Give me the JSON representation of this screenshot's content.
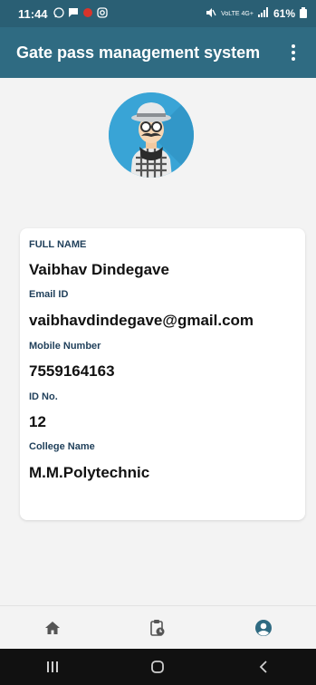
{
  "status_bar": {
    "time": "11:44",
    "signal_text": "VoLTE 4G+",
    "battery": "61%"
  },
  "app_bar": {
    "title": "Gate pass management system"
  },
  "profile": {
    "fields": [
      {
        "label": "FULL NAME",
        "value": "Vaibhav Dindegave"
      },
      {
        "label": "Email ID",
        "value": "vaibhavdindegave@gmail.com"
      },
      {
        "label": "Mobile Number",
        "value": "7559164163"
      },
      {
        "label": "ID No.",
        "value": "12"
      },
      {
        "label": "College Name",
        "value": "M.M.Polytechnic"
      }
    ]
  },
  "bottom_nav": {
    "items": [
      {
        "name": "home",
        "icon": "home-icon",
        "active": false
      },
      {
        "name": "history",
        "icon": "clipboard-clock-icon",
        "active": false
      },
      {
        "name": "profile",
        "icon": "account-circle-icon",
        "active": true
      }
    ],
    "active_color": "#2f6b82"
  },
  "colors": {
    "status_bar": "#2a5f74",
    "app_bar": "#2f6b82",
    "avatar_bg": "#39a4d6",
    "label": "#1f3f5a"
  }
}
